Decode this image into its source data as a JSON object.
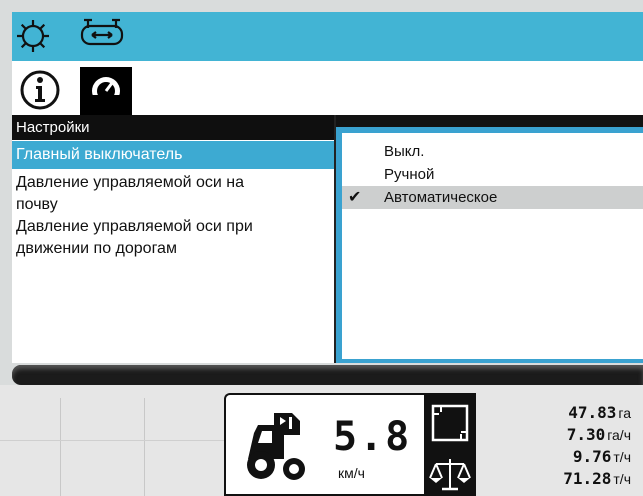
{
  "tabs": {
    "top": [
      {
        "icon": "gear-icon"
      },
      {
        "icon": "steering-axle-icon"
      }
    ],
    "second": [
      {
        "icon": "info-icon"
      },
      {
        "icon": "gauge-icon"
      }
    ]
  },
  "menu": {
    "title": "Настройки",
    "items": [
      {
        "label": "Главный выключатель",
        "selected": true
      },
      {
        "label_line1": "Давление управляемой оси на",
        "label_line2": "почву"
      },
      {
        "label_line1": "Давление управляемой оси при",
        "label_line2": "движении по дорогам"
      }
    ]
  },
  "options": {
    "items": [
      {
        "label": "Выкл.",
        "checked": false
      },
      {
        "label": "Ручной",
        "checked": false
      },
      {
        "label": "Автоматическое",
        "checked": true
      }
    ],
    "check_glyph": "✔"
  },
  "status": {
    "speed": {
      "value": "5.8",
      "unit": "км/ч"
    },
    "stats": [
      {
        "value": "47.83",
        "unit": "га"
      },
      {
        "value": "7.30",
        "unit": "га/ч"
      },
      {
        "value": "9.76",
        "unit": "т/ч"
      },
      {
        "value": "71.28",
        "unit": "т/ч"
      }
    ]
  },
  "colors": {
    "accent": "#42b4d4",
    "selection": "#3daad2",
    "checked_row": "#cdcfcf"
  }
}
